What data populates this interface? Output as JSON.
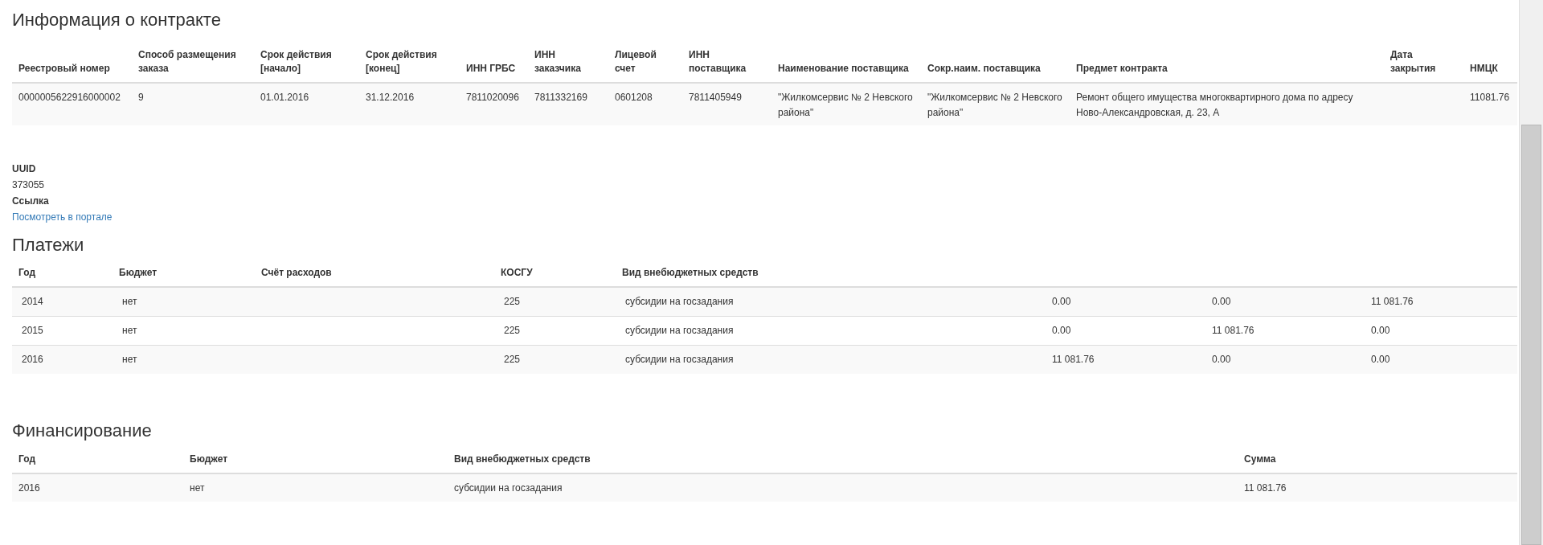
{
  "contract": {
    "title": "Информация о контракте",
    "columns": [
      "Реестровый номер",
      "Способ размещения заказа",
      "Срок действия [начало]",
      "Срок действия [конец]",
      "ИНН ГРБС",
      "ИНН заказчика",
      "Лицевой счет",
      "ИНН поставщика",
      "Наименование поставщика",
      "Сокр.наим. поставщика",
      "Предмет контракта",
      "Дата закрытия",
      "НМЦК"
    ],
    "rows": [
      [
        "0000005622916000002",
        "9",
        "01.01.2016",
        "31.12.2016",
        "7811020096",
        "7811332169",
        "0601208",
        "7811405949",
        "\"Жилкомсервис № 2 Невского района\"",
        "\"Жилкомсервис № 2 Невского района\"",
        "Ремонт общего имущества многоквартирного дома по адресу Ново-Александровская, д. 23, А",
        "",
        "11081.76"
      ]
    ]
  },
  "details": [
    {
      "label": "UUID",
      "value": "373055"
    },
    {
      "label": "Ссылка",
      "link": "Посмотреть в портале"
    }
  ],
  "payments": {
    "title": "Платежи",
    "columns": [
      "Год",
      "Бюджет",
      "Счёт расходов",
      "КОСГУ",
      "Вид внебюджетных средств",
      "",
      "",
      ""
    ],
    "rows": [
      [
        "2014",
        "нет",
        "",
        "225",
        "субсидии на госзадания",
        "0.00",
        "0.00",
        "11 081.76"
      ],
      [
        "2015",
        "нет",
        "",
        "225",
        "субсидии на госзадания",
        "0.00",
        "11 081.76",
        "0.00"
      ],
      [
        "2016",
        "нет",
        "",
        "225",
        "субсидии на госзадания",
        "11 081.76",
        "0.00",
        "0.00"
      ]
    ]
  },
  "financing": {
    "title": "Финансирование",
    "columns": [
      "Год",
      "Бюджет",
      "Вид внебюджетных средств",
      "Сумма"
    ],
    "rows": [
      [
        "2016",
        "нет",
        "субсидии на госзадания",
        "11 081.76"
      ]
    ]
  }
}
